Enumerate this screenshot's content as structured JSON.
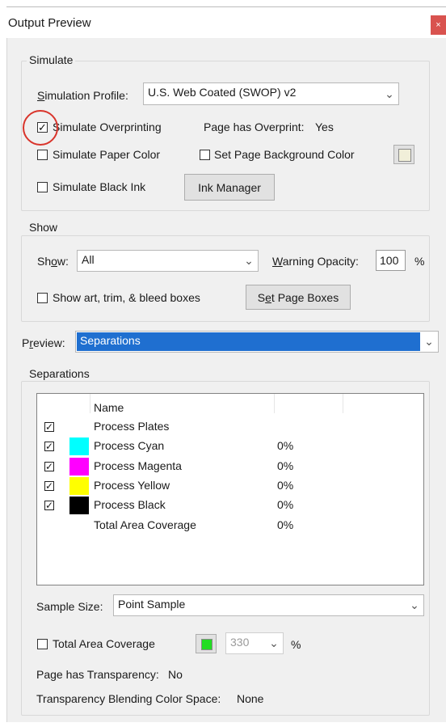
{
  "window": {
    "title": "Output Preview",
    "close_glyph": "×"
  },
  "simulate": {
    "legend": "Simulate",
    "profile_label": "Simulation Profile:",
    "profile_value": "U.S. Web Coated (SWOP) v2",
    "overprint_label": "Simulate Overprinting",
    "overprint_checked": true,
    "page_overprint_label": "Page has Overprint:",
    "page_overprint_value": "Yes",
    "paper_color_label": "Simulate Paper Color",
    "page_bg_label": "Set Page Background Color",
    "page_bg_swatch": "#f1efd9",
    "black_ink_label": "Simulate Black Ink",
    "ink_manager_label": "Ink Manager"
  },
  "show": {
    "legend": "Show",
    "show_label": "Show:",
    "show_value": "All",
    "warning_label": "Warning Opacity:",
    "warning_value": "100",
    "warning_unit": "%",
    "boxes_label": "Show art, trim, & bleed boxes",
    "page_boxes_button": "Set Page Boxes"
  },
  "preview": {
    "label": "Preview:",
    "value": "Separations"
  },
  "separations": {
    "legend": "Separations",
    "column_name": "Name",
    "rows": [
      {
        "checked": true,
        "color": "",
        "name": "Process Plates",
        "coverage": ""
      },
      {
        "checked": true,
        "color": "#00ffff",
        "name": "Process Cyan",
        "coverage": "0%"
      },
      {
        "checked": true,
        "color": "#ff00ff",
        "name": "Process Magenta",
        "coverage": "0%"
      },
      {
        "checked": true,
        "color": "#ffff00",
        "name": "Process Yellow",
        "coverage": "0%"
      },
      {
        "checked": true,
        "color": "#000000",
        "name": "Process Black",
        "coverage": "0%"
      },
      {
        "checked": false,
        "color": "",
        "name": "Total Area Coverage",
        "coverage": "0%"
      }
    ],
    "sample_label": "Sample Size:",
    "sample_value": "Point Sample",
    "tac_label": "Total Area Coverage",
    "tac_swatch": "#22dd22",
    "tac_value": "330",
    "tac_unit": "%",
    "transparency_label": "Page has Transparency:",
    "transparency_value": "No",
    "blend_label": "Transparency Blending Color Space:",
    "blend_value": "None"
  },
  "icons": {
    "chevron": "⌄",
    "check": "✓"
  }
}
